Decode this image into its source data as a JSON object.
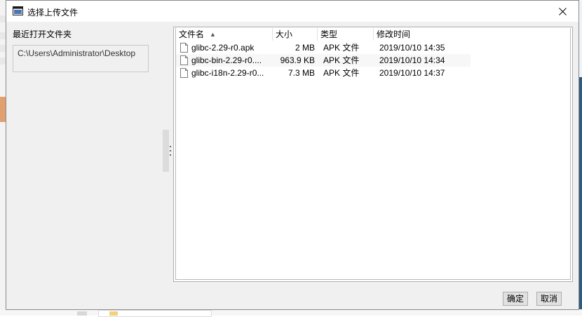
{
  "dialog": {
    "title": "选择上传文件",
    "ok_label": "确定",
    "cancel_label": "取消"
  },
  "left_panel": {
    "recent_label": "最近打开文件夹",
    "recent_path": "C:\\Users\\Administrator\\Desktop"
  },
  "columns": [
    {
      "label": "文件名"
    },
    {
      "label": "大小"
    },
    {
      "label": "类型"
    },
    {
      "label": "修改时间"
    }
  ],
  "files": [
    {
      "name": "glibc-2.29-r0.apk",
      "size": "2 MB",
      "type": "APK 文件",
      "modified": "2019/10/10 14:35"
    },
    {
      "name": "glibc-bin-2.29-r0....",
      "size": "963.9 KB",
      "type": "APK 文件",
      "modified": "2019/10/10 14:34"
    },
    {
      "name": "glibc-i18n-2.29-r0...",
      "size": "7.3 MB",
      "type": "APK 文件",
      "modified": "2019/10/10 14:37"
    }
  ],
  "icons": {
    "app": "window-icon",
    "close": "close-icon",
    "file": "file-icon",
    "sort": "sort-up-icon"
  }
}
